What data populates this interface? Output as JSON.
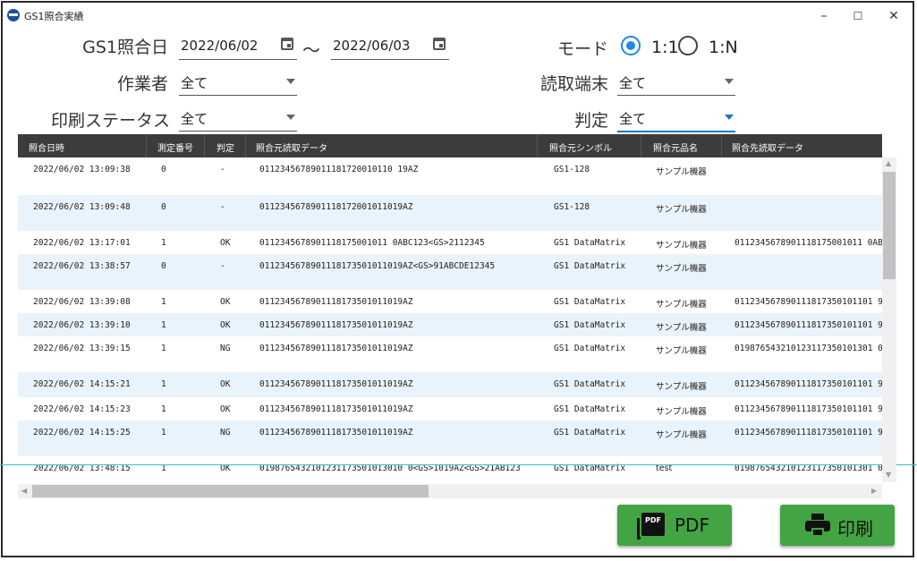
{
  "window": {
    "title": "GS1照合実績",
    "minimize": "–",
    "maximize": "☐",
    "close": "✕"
  },
  "filters": {
    "date_label": "GS1照合日",
    "date_from": "2022/06/02",
    "date_to": "2022/06/03",
    "range_sep": "～",
    "worker_label": "作業者",
    "worker_value": "全て",
    "print_status_label": "印刷ステータス",
    "print_status_value": "全て",
    "mode_label": "モード",
    "mode_options": [
      "1:1",
      "1:N"
    ],
    "mode_selected": "1:1",
    "terminal_label": "読取端末",
    "terminal_value": "全て",
    "judge_label": "判定",
    "judge_value": "全て"
  },
  "table": {
    "columns": [
      "照合日時",
      "測定番号",
      "判定",
      "照合元読取データ",
      "照合元シンボル",
      "照合元品名",
      "照合先読取データ"
    ],
    "rows": [
      {
        "datetime": "2022/06/02 13:09:38",
        "num": "0",
        "judge": "-",
        "src": "01123456789011181720010110 19AZ",
        "sym": "GS1-128",
        "item": "サンプル機器",
        "dst": ""
      },
      {
        "datetime": "2022/06/02 13:09:48",
        "num": "0",
        "judge": "-",
        "src": "0112345678901118172001011019AZ",
        "sym": "GS1-128",
        "item": "サンプル機器",
        "dst": ""
      },
      {
        "datetime": "2022/06/02 13:17:01",
        "num": "1",
        "judge": "OK",
        "src": "0112345678901118175001011 0ABC123<GS>2112345",
        "sym": "GS1 DataMatrix",
        "item": "サンプル機器",
        "dst": "0112345678901118175001011 0AB"
      },
      {
        "datetime": "2022/06/02 13:38:57",
        "num": "0",
        "judge": "-",
        "src": "0112345678901118173501011019AZ<GS>91ABCDE12345",
        "sym": "GS1 DataMatrix",
        "item": "サンプル機器",
        "dst": ""
      },
      {
        "datetime": "2022/06/02 13:39:08",
        "num": "1",
        "judge": "OK",
        "src": "0112345678901118173501011019AZ",
        "sym": "GS1 DataMatrix",
        "item": "サンプル機器",
        "dst": "011234567890111817350101101 9"
      },
      {
        "datetime": "2022/06/02 13:39:10",
        "num": "1",
        "judge": "OK",
        "src": "0112345678901118173501011019AZ",
        "sym": "GS1 DataMatrix",
        "item": "サンプル機器",
        "dst": "011234567890111817350101101 9"
      },
      {
        "datetime": "2022/06/02 13:39:15",
        "num": "1",
        "judge": "NG",
        "src": "0112345678901118173501011019AZ",
        "sym": "GS1 DataMatrix",
        "item": "サンプル機器",
        "dst": "019876543210123117350101301 0"
      },
      {
        "datetime": "2022/06/02 14:15:21",
        "num": "1",
        "judge": "OK",
        "src": "0112345678901118173501011019AZ",
        "sym": "GS1 DataMatrix",
        "item": "サンプル機器",
        "dst": "011234567890111817350101101 9"
      },
      {
        "datetime": "2022/06/02 14:15:23",
        "num": "1",
        "judge": "OK",
        "src": "0112345678901118173501011019AZ",
        "sym": "GS1 DataMatrix",
        "item": "サンプル機器",
        "dst": "011234567890111817350101101 9"
      },
      {
        "datetime": "2022/06/02 14:15:25",
        "num": "1",
        "judge": "NG",
        "src": "0112345678901118173501011019AZ",
        "sym": "GS1 DataMatrix",
        "item": "サンプル機器",
        "dst": "011234567890111817350101101 9"
      },
      {
        "datetime": "2022/06/02 13:48:15",
        "num": "1",
        "judge": "OK",
        "src": "0198765432101231173501013010 0<GS>1019AZ<GS>21AB123",
        "sym": "GS1 DataMatrix",
        "item": "test",
        "dst": "019876543210123117350101301 0"
      }
    ]
  },
  "buttons": {
    "pdf": "PDF",
    "print": "印刷",
    "pdf_icon_text": "PDF"
  },
  "colors": {
    "header_bg": "#3c3c3c",
    "alt_row": "#e9f3fb",
    "button_green": "#43a443",
    "accent_blue": "#1e88e5"
  }
}
